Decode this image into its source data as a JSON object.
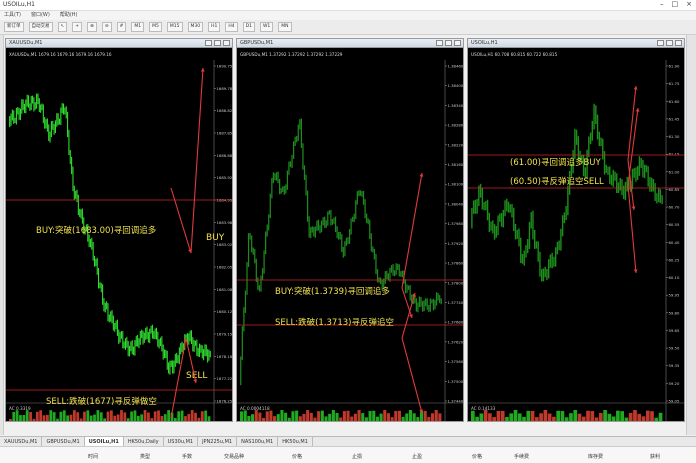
{
  "app": {
    "title": "USOILu,H1"
  },
  "menu": [
    "工具(T)",
    "窗口(W)",
    "帮助(H)"
  ],
  "toolbar": {
    "new_order": "新订单",
    "autotrade": "自动交易",
    "periods": [
      "M1",
      "M5",
      "M15",
      "M30",
      "H1",
      "H4",
      "D1",
      "W1",
      "MN"
    ]
  },
  "charts": [
    {
      "window_title": "XAUUSDu,M1",
      "info": "XAUUSDu,M1 1679.16 1679.16 1679.16 1679.16",
      "indicator": "AC 0.3319",
      "prices": [
        "1690.75",
        "1689.78",
        "1688.82",
        "1687.85",
        "1686.88",
        "1685.92",
        "1684.95",
        "1683.98",
        "1683.02",
        "1682.05",
        "1681.08",
        "1680.12",
        "1679.15",
        "1678.18",
        "1677.22",
        "1676.25"
      ],
      "annotations": {
        "buy": "BUY:突破(1683.00)寻回调追多",
        "buy_tag": "BUY",
        "sell": "SELL:跌破(1677)寻反弹做空",
        "sell_tag": "SELL"
      }
    },
    {
      "window_title": "GBPUSDu,M1",
      "info": "GBPUSDu,M1 1.37292 1.37292 1.37292 1.37229",
      "indicator": "AC 0.0004118",
      "prices": [
        "1.38460",
        "1.38400",
        "1.38340",
        "1.38280",
        "1.38220",
        "1.38160",
        "1.38100",
        "1.38040",
        "1.37980",
        "1.37920",
        "1.37860",
        "1.37800",
        "1.37740",
        "1.37680",
        "1.37620",
        "1.37560",
        "1.37500",
        "1.37440"
      ],
      "annotations": {
        "buy": "BUY:突破(1.3739)寻回调追多",
        "sell": "SELL:跌破(1.3713)寻反弹追空"
      }
    },
    {
      "window_title": "USOILu,H1",
      "info": "USOILu,H1 60.708 60.815 60.722 60.815",
      "indicator": "AC 0.14133",
      "prices": [
        "61.90",
        "61.75",
        "61.60",
        "61.45",
        "61.30",
        "61.15",
        "61.00",
        "60.85",
        "60.70",
        "60.55",
        "60.40",
        "60.25",
        "60.10",
        "59.95",
        "59.80",
        "59.65",
        "59.50",
        "59.35",
        "59.20",
        "59.05"
      ],
      "annotations": {
        "buy": "(61.00)寻回调追多BUY",
        "sell": "(60.50)寻反弹追空SELL"
      }
    }
  ],
  "bottom_tabs": [
    "XAUUSDu,M1",
    "GBPUSDu,M1",
    "USOILu,H1",
    "HK50u,Daily",
    "US30u,M1",
    "JPN225u,M1",
    "NAS100u,M1",
    "HK50u,M1"
  ],
  "columns": [
    "时间",
    "类型",
    "手数",
    "交易品种",
    "价格",
    "止损",
    "止盈",
    "价格",
    "手续费",
    "库存费",
    "获利"
  ]
}
